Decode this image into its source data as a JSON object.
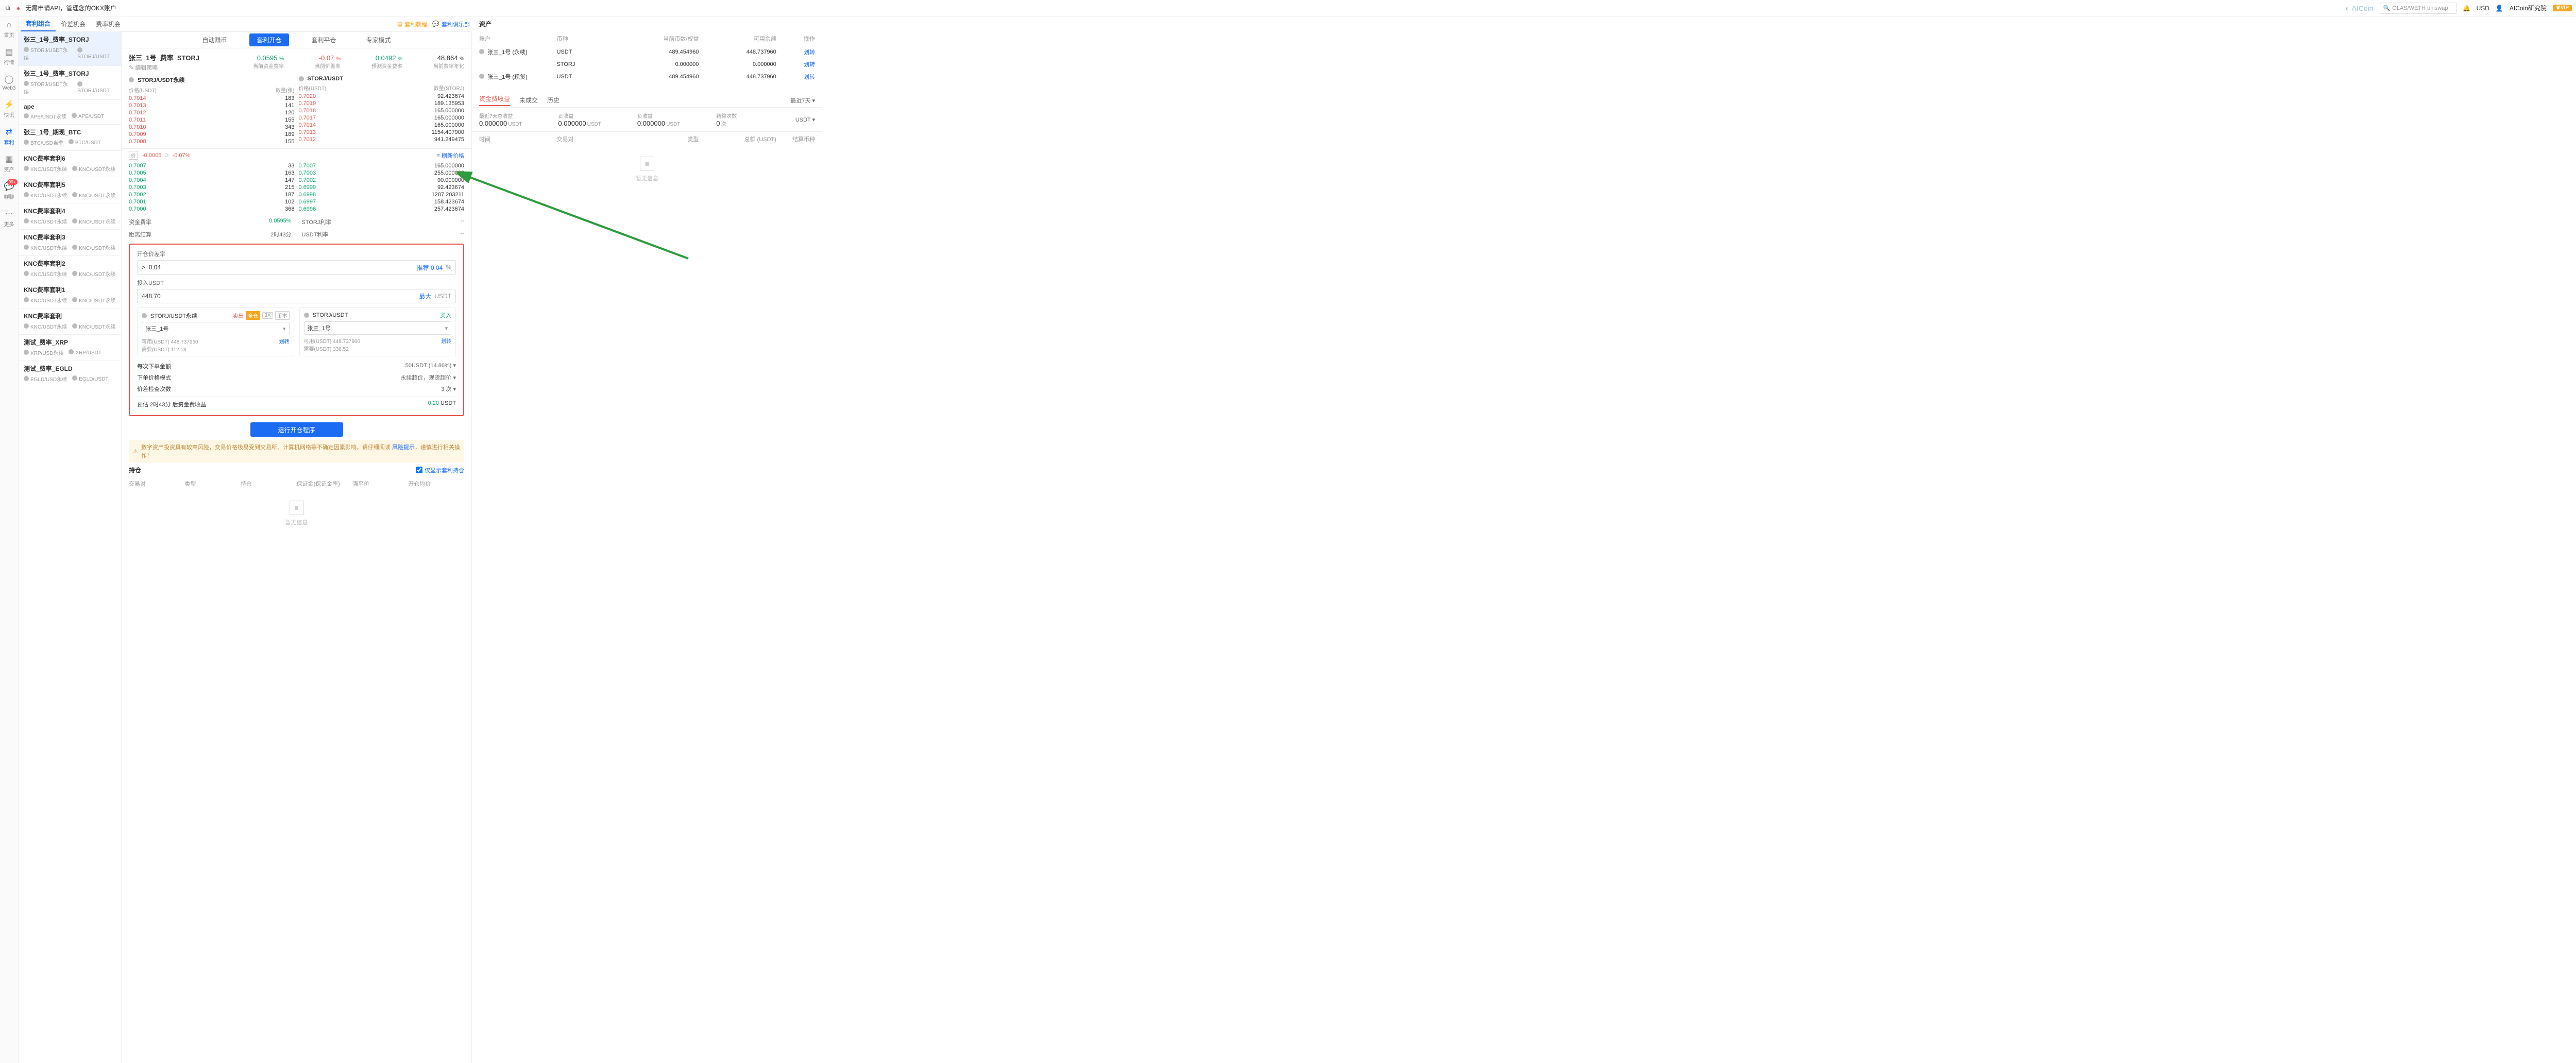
{
  "topbar": {
    "promo": "无需申请API，管理您的OKX账户",
    "logo": "AICoin",
    "search_placeholder": "OLAS/WETH uniswap",
    "currency": "USD",
    "user": "AICoin研究院",
    "vip": "VIP"
  },
  "sidenav": [
    {
      "label": "首页"
    },
    {
      "label": "行情"
    },
    {
      "label": "Web3"
    },
    {
      "label": "快讯"
    },
    {
      "label": "套利",
      "active": true
    },
    {
      "label": "资产"
    },
    {
      "label": "群聊",
      "badge": "99+"
    },
    {
      "label": "更多"
    }
  ],
  "left_tabs": [
    "套利组合",
    "价差机会",
    "费率机会"
  ],
  "left_tabs_active": 0,
  "top_actions": {
    "tutorial": "套利教程",
    "club": "套利俱乐部"
  },
  "strategies": [
    {
      "title": "张三_1号_费率_STORJ",
      "pairs": [
        "STORJ/USDT永续",
        "STORJ/USDT"
      ],
      "selected": true
    },
    {
      "title": "张三_1号_费率_STORJ",
      "pairs": [
        "STORJ/USDT永续",
        "STORJ/USDT"
      ]
    },
    {
      "title": "ape",
      "pairs": [
        "APE/USDT永续",
        "APE/USDT"
      ]
    },
    {
      "title": "张三_1号_期现_BTC",
      "pairs": [
        "BTC/USD当季",
        "BTC/USDT"
      ]
    },
    {
      "title": "KNC费率套利6",
      "pairs": [
        "KNC/USDT永续",
        "KNC/USDT永续"
      ]
    },
    {
      "title": "KNC费率套利5",
      "pairs": [
        "KNC/USDT永续",
        "KNC/USDT永续"
      ]
    },
    {
      "title": "KNC费率套利4",
      "pairs": [
        "KNC/USDT永续",
        "KNC/USDT永续"
      ]
    },
    {
      "title": "KNC费率套利3",
      "pairs": [
        "KNC/USDT永续",
        "KNC/USDT永续"
      ]
    },
    {
      "title": "KNC费率套利2",
      "pairs": [
        "KNC/USDT永续",
        "KNC/USDT永续"
      ]
    },
    {
      "title": "KNC费率套利1",
      "pairs": [
        "KNC/USDT永续",
        "KNC/USDT永续"
      ]
    },
    {
      "title": "KNC费率套利",
      "pairs": [
        "KNC/USDT永续",
        "KNC/USDT永续"
      ]
    },
    {
      "title": "测试_费率_XRP",
      "pairs": [
        "XRP/USD永续",
        "XRP/USDT"
      ]
    },
    {
      "title": "测试_费率_EGLD",
      "pairs": [
        "EGLD/USD永续",
        "EGLD/USDT"
      ]
    }
  ],
  "center_tabs": [
    "自动赚币",
    "套利开仓",
    "套利平仓",
    "专家模式"
  ],
  "center_tabs_active": 1,
  "header": {
    "title": "张三_1号_费率_STORJ",
    "edit": "编辑策略",
    "metrics": [
      {
        "val": "0.0595",
        "unit": "%",
        "lbl": "当前资金费率",
        "cls": "green"
      },
      {
        "val": "-0.07",
        "unit": "%",
        "lbl": "当前价差率",
        "cls": "red"
      },
      {
        "val": "0.0492",
        "unit": "%",
        "lbl": "预测资金费率",
        "cls": "green"
      },
      {
        "val": "48.864",
        "unit": "%",
        "lbl": "当前费率年化",
        "cls": ""
      }
    ]
  },
  "depth": {
    "left": {
      "name": "STORJ/USDT永续",
      "sub": [
        "价格(USDT)",
        "数量(张)"
      ],
      "asks": [
        [
          "0.7014",
          "183"
        ],
        [
          "0.7013",
          "141"
        ],
        [
          "0.7012",
          "120"
        ],
        [
          "0.7011",
          "155"
        ],
        [
          "0.7010",
          "343"
        ],
        [
          "0.7009",
          "189"
        ],
        [
          "0.7008",
          "155"
        ]
      ],
      "bids": [
        [
          "0.7007",
          "33"
        ],
        [
          "0.7005",
          "163"
        ],
        [
          "0.7004",
          "147"
        ],
        [
          "0.7003",
          "215"
        ],
        [
          "0.7002",
          "187"
        ],
        [
          "0.7001",
          "102"
        ],
        [
          "0.7000",
          "368"
        ]
      ]
    },
    "right": {
      "name": "STORJ/USDT",
      "sub": [
        "价格(USDT)",
        "数量(STORJ)"
      ],
      "asks": [
        [
          "0.7020",
          "92.423674"
        ],
        [
          "0.7019",
          "189.135953"
        ],
        [
          "0.7018",
          "165.000000"
        ],
        [
          "0.7017",
          "165.000000"
        ],
        [
          "0.7014",
          "165.000000"
        ],
        [
          "0.7013",
          "1154.407900"
        ],
        [
          "0.7012",
          "941.249475"
        ]
      ],
      "bids": [
        [
          "0.7007",
          "165.000000"
        ],
        [
          "0.7003",
          "255.000000"
        ],
        [
          "0.7002",
          "90.000000"
        ],
        [
          "0.6999",
          "92.423674"
        ],
        [
          "0.6998",
          "1287.203211"
        ],
        [
          "0.6997",
          "158.423674"
        ],
        [
          "0.6996",
          "257.423674"
        ]
      ]
    },
    "summary": {
      "badge": "价",
      "diff": "-0.0005",
      "pct": "-0.07",
      "refresh": "刷新价格"
    },
    "fee": {
      "l1": "资金费率",
      "l2": "距离结算",
      "v1": "0.0595%",
      "v2": "2时43分",
      "r1": "STORJ利率",
      "r2": "USDT利率",
      "rv": "--"
    }
  },
  "form": {
    "spread_lbl": "开仓价差率",
    "spread_val": "0.04",
    "spread_prefix": ">",
    "recommend": "推荐 0.04",
    "pct": "%",
    "invest_lbl": "投入USDT",
    "invest_val": "448.70",
    "max": "最大",
    "unit": "USDT",
    "left": {
      "pair": "STORJ/USDT永续",
      "side": "卖出",
      "pills": [
        "全仓",
        "3X",
        "币本"
      ],
      "account": "张三_1号",
      "avail_lbl": "可用(USDT)",
      "avail": "448.737960",
      "need_lbl": "需要(USDT)",
      "need": "112.18",
      "transfer": "划转"
    },
    "right": {
      "pair": "STORJ/USDT",
      "side": "买入",
      "account": "张三_1号",
      "avail_lbl": "可用(USDT)",
      "avail": "448.737960",
      "need_lbl": "需要(USDT)",
      "need": "336.52",
      "transfer": "划转"
    },
    "opts": [
      {
        "l": "每次下单金额",
        "r": "50USDT (14.86%)"
      },
      {
        "l": "下单价格模式",
        "r": "永续超价，现货超价"
      },
      {
        "l": "价差检查次数",
        "r": "3 次"
      }
    ],
    "predict": {
      "l": "预估 2时43分 后资金费收益",
      "r": "0.20",
      "u": "USDT"
    },
    "run": "运行开仓程序"
  },
  "warn": {
    "text": "数字资产投资具有较高风险，交易价格极易受到交易所、计算机网络等不确定因素影响，请仔细阅读",
    "link": "风险提示",
    "tail": "，谨慎进行相关操作！"
  },
  "positions": {
    "title": "持仓",
    "only": "仅显示套利持仓",
    "cols": [
      "交易对",
      "类型",
      "持仓",
      "保证金(保证金率)",
      "强平价",
      "开仓均价"
    ],
    "empty": "暂无信息"
  },
  "assets": {
    "title": "资产",
    "cols": [
      "账户",
      "币种",
      "当前币数/权益",
      "可用余额",
      "操作"
    ],
    "rows": [
      {
        "acc": "张三_1号 (永续)",
        "coin": "USDT",
        "qty": "489.454960",
        "avail": "448.737960",
        "action": "划转"
      },
      {
        "acc": "",
        "coin": "STORJ",
        "qty": "0.000000",
        "avail": "0.000000",
        "action": "划转"
      },
      {
        "acc": "张三_1号 (现货)",
        "coin": "USDT",
        "qty": "489.454960",
        "avail": "448.737960",
        "action": "划转"
      }
    ]
  },
  "pnl": {
    "tabs": [
      "资金费收益",
      "未成交",
      "历史"
    ],
    "active": 0,
    "filter": "最近7天",
    "filter2": "USDT",
    "stats": [
      {
        "l": "最近7天总收益",
        "v": "0.000000",
        "u": "USDT"
      },
      {
        "l": "正收益",
        "v": "0.000000",
        "u": "USDT"
      },
      {
        "l": "负收益",
        "v": "0.000000",
        "u": "USDT"
      },
      {
        "l": "结算次数",
        "v": "0",
        "u": "次"
      }
    ],
    "cols": [
      "时间",
      "交易对",
      "类型",
      "总额 (USDT)",
      "结算币种"
    ],
    "empty": "暂无信息"
  }
}
